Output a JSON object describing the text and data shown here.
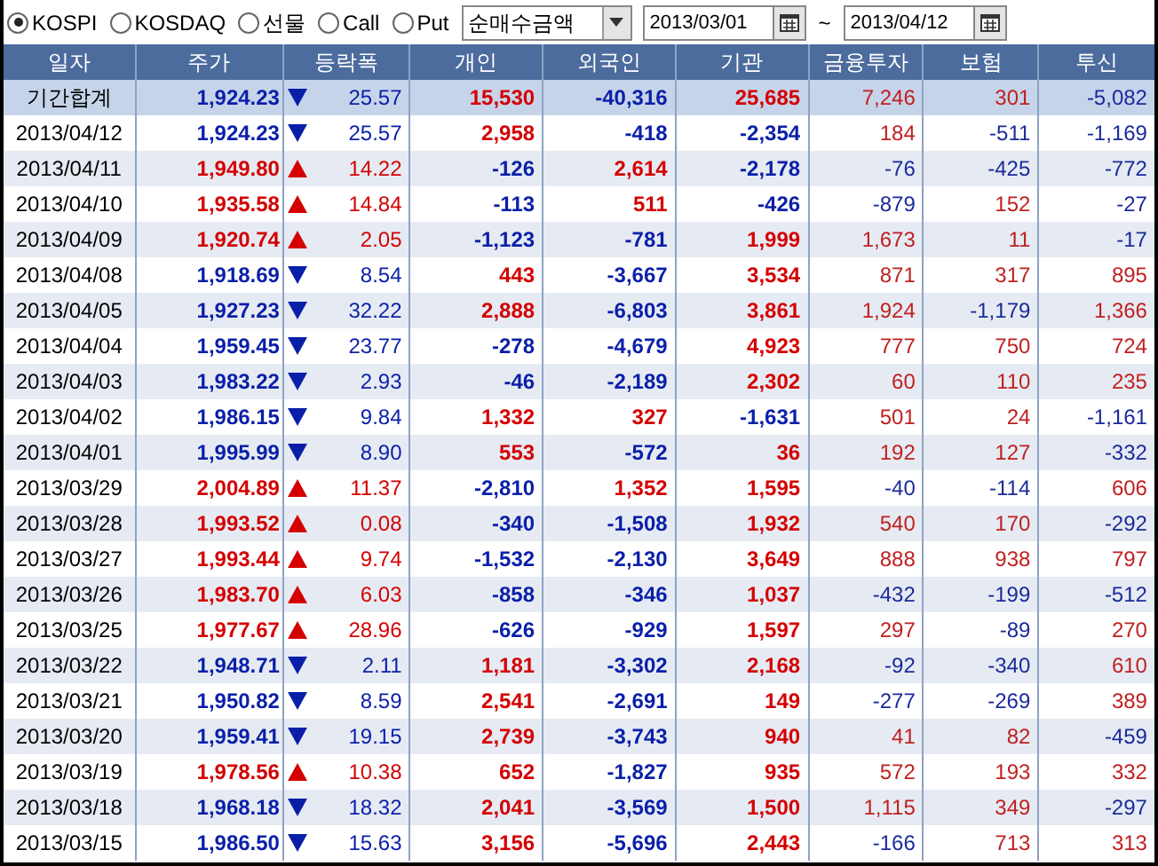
{
  "markets": [
    {
      "label": "KOSPI",
      "selected": true
    },
    {
      "label": "KOSDAQ",
      "selected": false
    },
    {
      "label": "선물",
      "selected": false
    },
    {
      "label": "Call",
      "selected": false
    },
    {
      "label": "Put",
      "selected": false
    }
  ],
  "metric": {
    "value": "순매수금액"
  },
  "date_from": {
    "value": "2013/03/01"
  },
  "range_sep": "~",
  "date_to": {
    "value": "2013/04/12"
  },
  "table": {
    "columns": [
      "일자",
      "주가",
      "등락폭",
      "개인",
      "외국인",
      "기관",
      "금융투자",
      "보험",
      "투신"
    ],
    "summary": {
      "date": "기간합계",
      "price": "1,924.23",
      "rising": false,
      "change": "25.57",
      "flows": [
        {
          "value": "15,530",
          "negative": false
        },
        {
          "value": "-40,316",
          "negative": true
        },
        {
          "value": "25,685",
          "negative": false
        },
        {
          "value": "7,246",
          "negative": false
        },
        {
          "value": "301",
          "negative": false
        },
        {
          "value": "-5,082",
          "negative": true
        }
      ]
    },
    "rows": [
      {
        "date": "2013/04/12",
        "price": "1,924.23",
        "rising": false,
        "change": "25.57",
        "flows": [
          {
            "value": "2,958",
            "negative": false
          },
          {
            "value": "-418",
            "negative": true
          },
          {
            "value": "-2,354",
            "negative": true
          },
          {
            "value": "184",
            "negative": false
          },
          {
            "value": "-511",
            "negative": true
          },
          {
            "value": "-1,169",
            "negative": true
          }
        ]
      },
      {
        "date": "2013/04/11",
        "price": "1,949.80",
        "rising": true,
        "change": "14.22",
        "flows": [
          {
            "value": "-126",
            "negative": true
          },
          {
            "value": "2,614",
            "negative": false
          },
          {
            "value": "-2,178",
            "negative": true
          },
          {
            "value": "-76",
            "negative": true
          },
          {
            "value": "-425",
            "negative": true
          },
          {
            "value": "-772",
            "negative": true
          }
        ]
      },
      {
        "date": "2013/04/10",
        "price": "1,935.58",
        "rising": true,
        "change": "14.84",
        "flows": [
          {
            "value": "-113",
            "negative": true
          },
          {
            "value": "511",
            "negative": false
          },
          {
            "value": "-426",
            "negative": true
          },
          {
            "value": "-879",
            "negative": true
          },
          {
            "value": "152",
            "negative": false
          },
          {
            "value": "-27",
            "negative": true
          }
        ]
      },
      {
        "date": "2013/04/09",
        "price": "1,920.74",
        "rising": true,
        "change": "2.05",
        "flows": [
          {
            "value": "-1,123",
            "negative": true
          },
          {
            "value": "-781",
            "negative": true
          },
          {
            "value": "1,999",
            "negative": false
          },
          {
            "value": "1,673",
            "negative": false
          },
          {
            "value": "11",
            "negative": false
          },
          {
            "value": "-17",
            "negative": true
          }
        ]
      },
      {
        "date": "2013/04/08",
        "price": "1,918.69",
        "rising": false,
        "change": "8.54",
        "flows": [
          {
            "value": "443",
            "negative": false
          },
          {
            "value": "-3,667",
            "negative": true
          },
          {
            "value": "3,534",
            "negative": false
          },
          {
            "value": "871",
            "negative": false
          },
          {
            "value": "317",
            "negative": false
          },
          {
            "value": "895",
            "negative": false
          }
        ]
      },
      {
        "date": "2013/04/05",
        "price": "1,927.23",
        "rising": false,
        "change": "32.22",
        "flows": [
          {
            "value": "2,888",
            "negative": false
          },
          {
            "value": "-6,803",
            "negative": true
          },
          {
            "value": "3,861",
            "negative": false
          },
          {
            "value": "1,924",
            "negative": false
          },
          {
            "value": "-1,179",
            "negative": true
          },
          {
            "value": "1,366",
            "negative": false
          }
        ]
      },
      {
        "date": "2013/04/04",
        "price": "1,959.45",
        "rising": false,
        "change": "23.77",
        "flows": [
          {
            "value": "-278",
            "negative": true
          },
          {
            "value": "-4,679",
            "negative": true
          },
          {
            "value": "4,923",
            "negative": false
          },
          {
            "value": "777",
            "negative": false
          },
          {
            "value": "750",
            "negative": false
          },
          {
            "value": "724",
            "negative": false
          }
        ]
      },
      {
        "date": "2013/04/03",
        "price": "1,983.22",
        "rising": false,
        "change": "2.93",
        "flows": [
          {
            "value": "-46",
            "negative": true
          },
          {
            "value": "-2,189",
            "negative": true
          },
          {
            "value": "2,302",
            "negative": false
          },
          {
            "value": "60",
            "negative": false
          },
          {
            "value": "110",
            "negative": false
          },
          {
            "value": "235",
            "negative": false
          }
        ]
      },
      {
        "date": "2013/04/02",
        "price": "1,986.15",
        "rising": false,
        "change": "9.84",
        "flows": [
          {
            "value": "1,332",
            "negative": false
          },
          {
            "value": "327",
            "negative": false
          },
          {
            "value": "-1,631",
            "negative": true
          },
          {
            "value": "501",
            "negative": false
          },
          {
            "value": "24",
            "negative": false
          },
          {
            "value": "-1,161",
            "negative": true
          }
        ]
      },
      {
        "date": "2013/04/01",
        "price": "1,995.99",
        "rising": false,
        "change": "8.90",
        "flows": [
          {
            "value": "553",
            "negative": false
          },
          {
            "value": "-572",
            "negative": true
          },
          {
            "value": "36",
            "negative": false
          },
          {
            "value": "192",
            "negative": false
          },
          {
            "value": "127",
            "negative": false
          },
          {
            "value": "-332",
            "negative": true
          }
        ]
      },
      {
        "date": "2013/03/29",
        "price": "2,004.89",
        "rising": true,
        "change": "11.37",
        "flows": [
          {
            "value": "-2,810",
            "negative": true
          },
          {
            "value": "1,352",
            "negative": false
          },
          {
            "value": "1,595",
            "negative": false
          },
          {
            "value": "-40",
            "negative": true
          },
          {
            "value": "-114",
            "negative": true
          },
          {
            "value": "606",
            "negative": false
          }
        ]
      },
      {
        "date": "2013/03/28",
        "price": "1,993.52",
        "rising": true,
        "change": "0.08",
        "flows": [
          {
            "value": "-340",
            "negative": true
          },
          {
            "value": "-1,508",
            "negative": true
          },
          {
            "value": "1,932",
            "negative": false
          },
          {
            "value": "540",
            "negative": false
          },
          {
            "value": "170",
            "negative": false
          },
          {
            "value": "-292",
            "negative": true
          }
        ]
      },
      {
        "date": "2013/03/27",
        "price": "1,993.44",
        "rising": true,
        "change": "9.74",
        "flows": [
          {
            "value": "-1,532",
            "negative": true
          },
          {
            "value": "-2,130",
            "negative": true
          },
          {
            "value": "3,649",
            "negative": false
          },
          {
            "value": "888",
            "negative": false
          },
          {
            "value": "938",
            "negative": false
          },
          {
            "value": "797",
            "negative": false
          }
        ]
      },
      {
        "date": "2013/03/26",
        "price": "1,983.70",
        "rising": true,
        "change": "6.03",
        "flows": [
          {
            "value": "-858",
            "negative": true
          },
          {
            "value": "-346",
            "negative": true
          },
          {
            "value": "1,037",
            "negative": false
          },
          {
            "value": "-432",
            "negative": true
          },
          {
            "value": "-199",
            "negative": true
          },
          {
            "value": "-512",
            "negative": true
          }
        ]
      },
      {
        "date": "2013/03/25",
        "price": "1,977.67",
        "rising": true,
        "change": "28.96",
        "flows": [
          {
            "value": "-626",
            "negative": true
          },
          {
            "value": "-929",
            "negative": true
          },
          {
            "value": "1,597",
            "negative": false
          },
          {
            "value": "297",
            "negative": false
          },
          {
            "value": "-89",
            "negative": true
          },
          {
            "value": "270",
            "negative": false
          }
        ]
      },
      {
        "date": "2013/03/22",
        "price": "1,948.71",
        "rising": false,
        "change": "2.11",
        "flows": [
          {
            "value": "1,181",
            "negative": false
          },
          {
            "value": "-3,302",
            "negative": true
          },
          {
            "value": "2,168",
            "negative": false
          },
          {
            "value": "-92",
            "negative": true
          },
          {
            "value": "-340",
            "negative": true
          },
          {
            "value": "610",
            "negative": false
          }
        ]
      },
      {
        "date": "2013/03/21",
        "price": "1,950.82",
        "rising": false,
        "change": "8.59",
        "flows": [
          {
            "value": "2,541",
            "negative": false
          },
          {
            "value": "-2,691",
            "negative": true
          },
          {
            "value": "149",
            "negative": false
          },
          {
            "value": "-277",
            "negative": true
          },
          {
            "value": "-269",
            "negative": true
          },
          {
            "value": "389",
            "negative": false
          }
        ]
      },
      {
        "date": "2013/03/20",
        "price": "1,959.41",
        "rising": false,
        "change": "19.15",
        "flows": [
          {
            "value": "2,739",
            "negative": false
          },
          {
            "value": "-3,743",
            "negative": true
          },
          {
            "value": "940",
            "negative": false
          },
          {
            "value": "41",
            "negative": false
          },
          {
            "value": "82",
            "negative": false
          },
          {
            "value": "-459",
            "negative": true
          }
        ]
      },
      {
        "date": "2013/03/19",
        "price": "1,978.56",
        "rising": true,
        "change": "10.38",
        "flows": [
          {
            "value": "652",
            "negative": false
          },
          {
            "value": "-1,827",
            "negative": true
          },
          {
            "value": "935",
            "negative": false
          },
          {
            "value": "572",
            "negative": false
          },
          {
            "value": "193",
            "negative": false
          },
          {
            "value": "332",
            "negative": false
          }
        ]
      },
      {
        "date": "2013/03/18",
        "price": "1,968.18",
        "rising": false,
        "change": "18.32",
        "flows": [
          {
            "value": "2,041",
            "negative": false
          },
          {
            "value": "-3,569",
            "negative": true
          },
          {
            "value": "1,500",
            "negative": false
          },
          {
            "value": "1,115",
            "negative": false
          },
          {
            "value": "349",
            "negative": false
          },
          {
            "value": "-297",
            "negative": true
          }
        ]
      },
      {
        "date": "2013/03/15",
        "price": "1,986.50",
        "rising": false,
        "change": "15.63",
        "flows": [
          {
            "value": "3,156",
            "negative": false
          },
          {
            "value": "-5,696",
            "negative": true
          },
          {
            "value": "2,443",
            "negative": false
          },
          {
            "value": "-166",
            "negative": true
          },
          {
            "value": "713",
            "negative": false
          },
          {
            "value": "313",
            "negative": false
          }
        ]
      }
    ]
  }
}
